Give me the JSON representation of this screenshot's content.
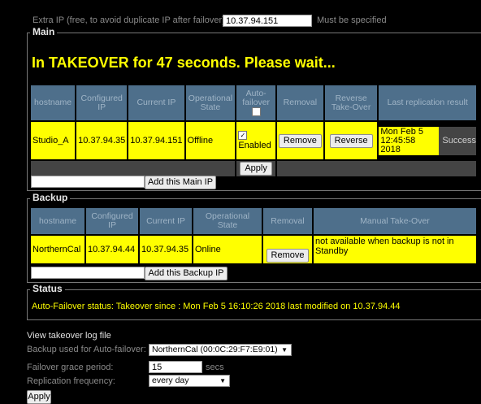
{
  "extra_ip": {
    "label": "Extra IP (free, to avoid duplicate IP after failover):",
    "value": "10.37.94.151",
    "note": "Must be specified"
  },
  "main": {
    "legend": "Main",
    "takeover_message": "In TAKEOVER for 47 seconds. Please wait...",
    "headers": {
      "hostname": "hostname",
      "configured_ip": "Configured IP",
      "current_ip": "Current IP",
      "operational_state": "Operational State",
      "auto_failover": "Auto-failover",
      "removal": "Removal",
      "reverse_takeover": "Reverse Take-Over",
      "last_replication": "Last replication result"
    },
    "row": {
      "hostname": "Studio_A",
      "configured_ip": "10.37.94.35",
      "current_ip": "10.37.94.151",
      "operational_state": "Offline",
      "enabled_label": "Enabled",
      "remove_label": "Remove",
      "reverse_label": "Reverse",
      "last_time": "Mon Feb 5 12:45:58 2018",
      "last_result": "Success"
    },
    "apply_label": "Apply",
    "add_ip_label": "Add this Main IP",
    "add_ip_value": ""
  },
  "backup": {
    "legend": "Backup",
    "headers": {
      "hostname": "hostname",
      "configured_ip": "Configured IP",
      "current_ip": "Current IP",
      "operational_state": "Operational State",
      "removal": "Removal",
      "manual_takeover": "Manual Take-Over"
    },
    "row": {
      "hostname": "NorthernCal",
      "configured_ip": "10.37.94.44",
      "current_ip": "10.37.94.35",
      "operational_state": "Online",
      "remove_label": "Remove",
      "manual_takeover_text": "not available when backup is not in Standby"
    },
    "add_ip_label": "Add this Backup IP",
    "add_ip_value": ""
  },
  "status": {
    "legend": "Status",
    "text": "Auto-Failover status: Takeover since : Mon Feb 5 16:10:26 2018 last modified on 10.37.94.44"
  },
  "settings": {
    "view_log_label": "View takeover log file",
    "backup_used_label": "Backup used for Auto-failover:",
    "backup_used_value": "NorthernCal (00:0C:29:F7:E9:01)",
    "grace_label": "Failover grace period:",
    "grace_value": "15",
    "grace_unit": "secs",
    "replication_label": "Replication frequency:",
    "replication_value": "every day",
    "apply_label": "Apply"
  },
  "colors": {
    "highlight": "#ffff00",
    "header_bg": "#4e6f8b",
    "background": "#000000"
  }
}
